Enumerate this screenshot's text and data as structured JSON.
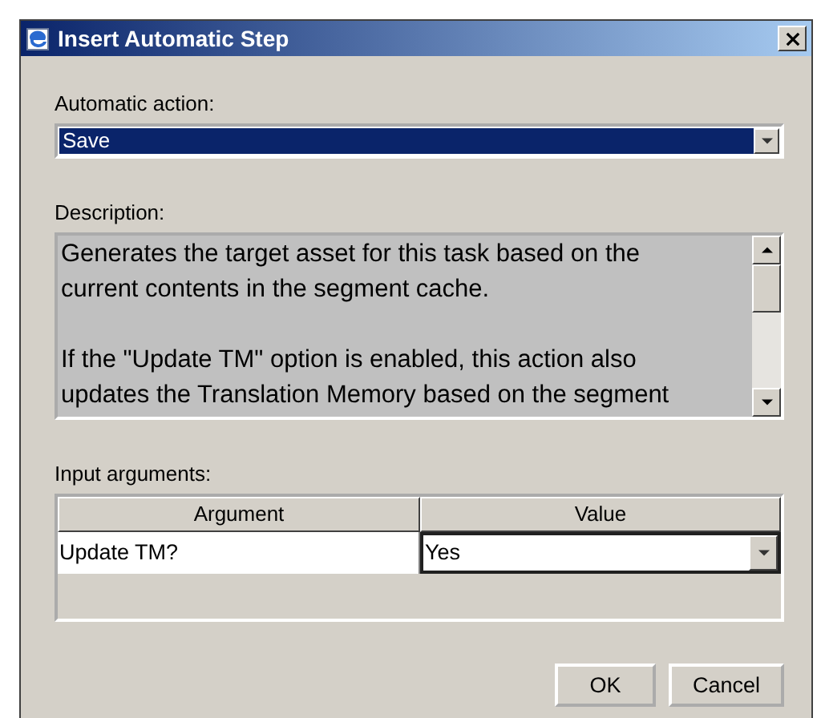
{
  "window": {
    "title": "Insert Automatic Step"
  },
  "action": {
    "label": "Automatic action:",
    "value": "Save",
    "highlighted": true
  },
  "description": {
    "label": "Description:",
    "paragraphs": [
      "Generates the target asset for this task based on the current contents in the segment cache.",
      "If the \"Update TM\" option is enabled, this action also updates the Translation Memory based on the segment"
    ]
  },
  "arguments": {
    "label": "Input arguments:",
    "columns": [
      "Argument",
      "Value"
    ],
    "rows": [
      {
        "argument": "Update TM?",
        "value": "Yes"
      }
    ]
  },
  "buttons": [
    "OK",
    "Cancel"
  ]
}
